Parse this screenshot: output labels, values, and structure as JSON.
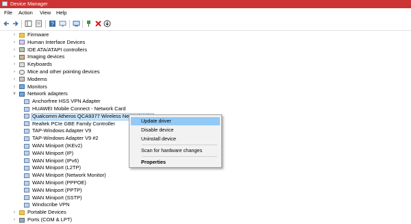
{
  "window": {
    "title": "Device Manager"
  },
  "menu": [
    "File",
    "Action",
    "View",
    "Help"
  ],
  "toolbar": {
    "buttons": [
      "back-arrow-icon",
      "forward-arrow-icon",
      "show-hide-tree-icon",
      "properties-icon",
      "help-icon",
      "update-driver-icon",
      "scan-hardware-icon",
      "enable-device-icon",
      "uninstall-icon",
      "download-driver-icon"
    ]
  },
  "tree": {
    "categories_top": [
      {
        "label": "Firmware",
        "icon": "folder-icon"
      },
      {
        "label": "Human Interface Devices",
        "icon": "hid-icon"
      },
      {
        "label": "IDE ATA/ATAPI controllers",
        "icon": "ide-icon"
      },
      {
        "label": "Imaging devices",
        "icon": "camera-icon"
      },
      {
        "label": "Keyboards",
        "icon": "keyboard-icon"
      },
      {
        "label": "Mice and other pointing devices",
        "icon": "mouse-icon"
      },
      {
        "label": "Modems",
        "icon": "modem-icon"
      },
      {
        "label": "Monitors",
        "icon": "monitor-icon"
      }
    ],
    "network": {
      "label": "Network adapters",
      "children": [
        "Anchorfree HSS VPN Adapter",
        "HUAWEI Mobile Connect - Network Card",
        "Qualcomm Atheros QCA9377 Wireless Network Adapter",
        "Realtek PCIe GBE Family Controller",
        "TAP-Windows Adapter V9",
        "TAP-Windows Adapter V9 #2",
        "WAN Miniport (IKEv2)",
        "WAN Miniport (IP)",
        "WAN Miniport (IPv6)",
        "WAN Miniport (L2TP)",
        "WAN Miniport (Network Monitor)",
        "WAN Miniport (PPPOE)",
        "WAN Miniport (PPTP)",
        "WAN Miniport (SSTP)",
        "Windscribe VPN"
      ]
    },
    "categories_bottom": [
      {
        "label": "Portable Devices",
        "icon": "folder-icon"
      },
      {
        "label": "Ports (COM & LPT)",
        "icon": "port-icon"
      }
    ]
  },
  "context_menu": {
    "update": "Update driver",
    "disable": "Disable device",
    "uninstall": "Uninstall device",
    "scan": "Scan for hardware changes",
    "properties": "Properties"
  }
}
